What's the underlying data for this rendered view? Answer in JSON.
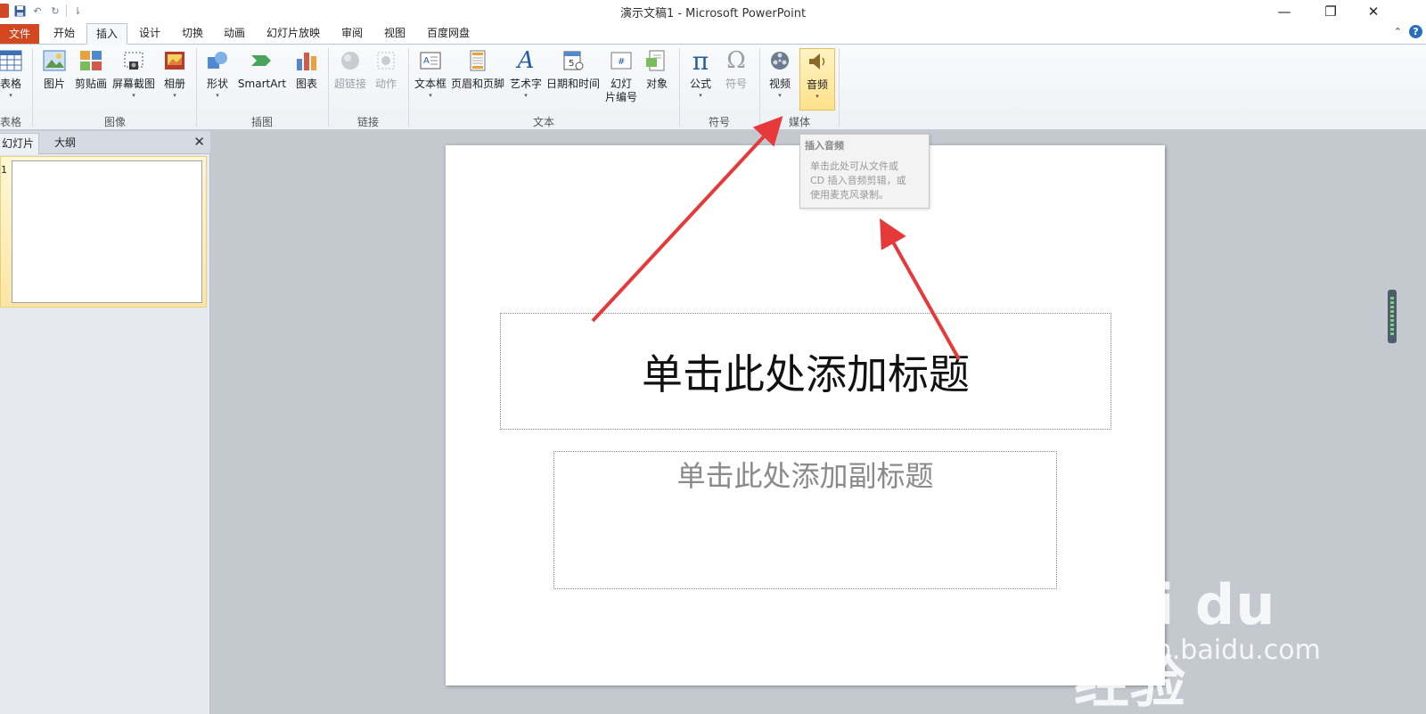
{
  "window": {
    "title": "演示文稿1 - Microsoft PowerPoint",
    "controls": {
      "minimize": "—",
      "restore": "❐",
      "close": "✕"
    }
  },
  "qat": {
    "undo": "↶",
    "redo": "↻",
    "more": "⇂"
  },
  "tabs": {
    "file": "文件",
    "items": [
      "开始",
      "插入",
      "设计",
      "切换",
      "动画",
      "幻灯片放映",
      "审阅",
      "视图",
      "百度网盘"
    ],
    "active": "插入",
    "help": "?",
    "collapse": "⌃"
  },
  "ribbon": {
    "groups": {
      "table": "表格",
      "images": "图像",
      "illustrations": "插图",
      "links": "链接",
      "text": "文本",
      "symbols": "符号",
      "media": "媒体"
    },
    "buttons": {
      "table": "表格",
      "picture": "图片",
      "clipart": "剪贴画",
      "screenshot": "屏幕截图",
      "album": "相册",
      "shapes": "形状",
      "smartart": "SmartArt",
      "chart": "图表",
      "hyperlink": "超链接",
      "action": "动作",
      "textbox": "文本框",
      "headerfooter": "页眉和页脚",
      "wordart": "艺术字",
      "datetime": "日期和时间",
      "slidenum_line1": "幻灯",
      "slidenum_line2": "片编号",
      "object": "对象",
      "equation": "公式",
      "symbol": "符号",
      "video": "视频",
      "audio": "音频"
    },
    "glyphs": {
      "pi": "π",
      "omega": "Ω",
      "wordart": "A",
      "dropdown": "▾"
    }
  },
  "tooltip": {
    "title": "插入音频",
    "body_lines": [
      "单击此处可从文件或",
      "CD 插入音频剪辑，或",
      "使用麦克风录制。"
    ]
  },
  "left_panel": {
    "tabs": [
      "幻灯片",
      "大纲"
    ],
    "close": "✕",
    "slide_number": "1"
  },
  "slide": {
    "title_placeholder": "单击此处添加标题",
    "subtitle_placeholder": "单击此处添加副标题"
  },
  "watermark": {
    "main": "Bai du 经验",
    "sub": "jingyan.baidu.com"
  },
  "colors": {
    "file_tab": "#d2471f",
    "hover": "#fde28a",
    "arrow": "#e63a3a"
  }
}
